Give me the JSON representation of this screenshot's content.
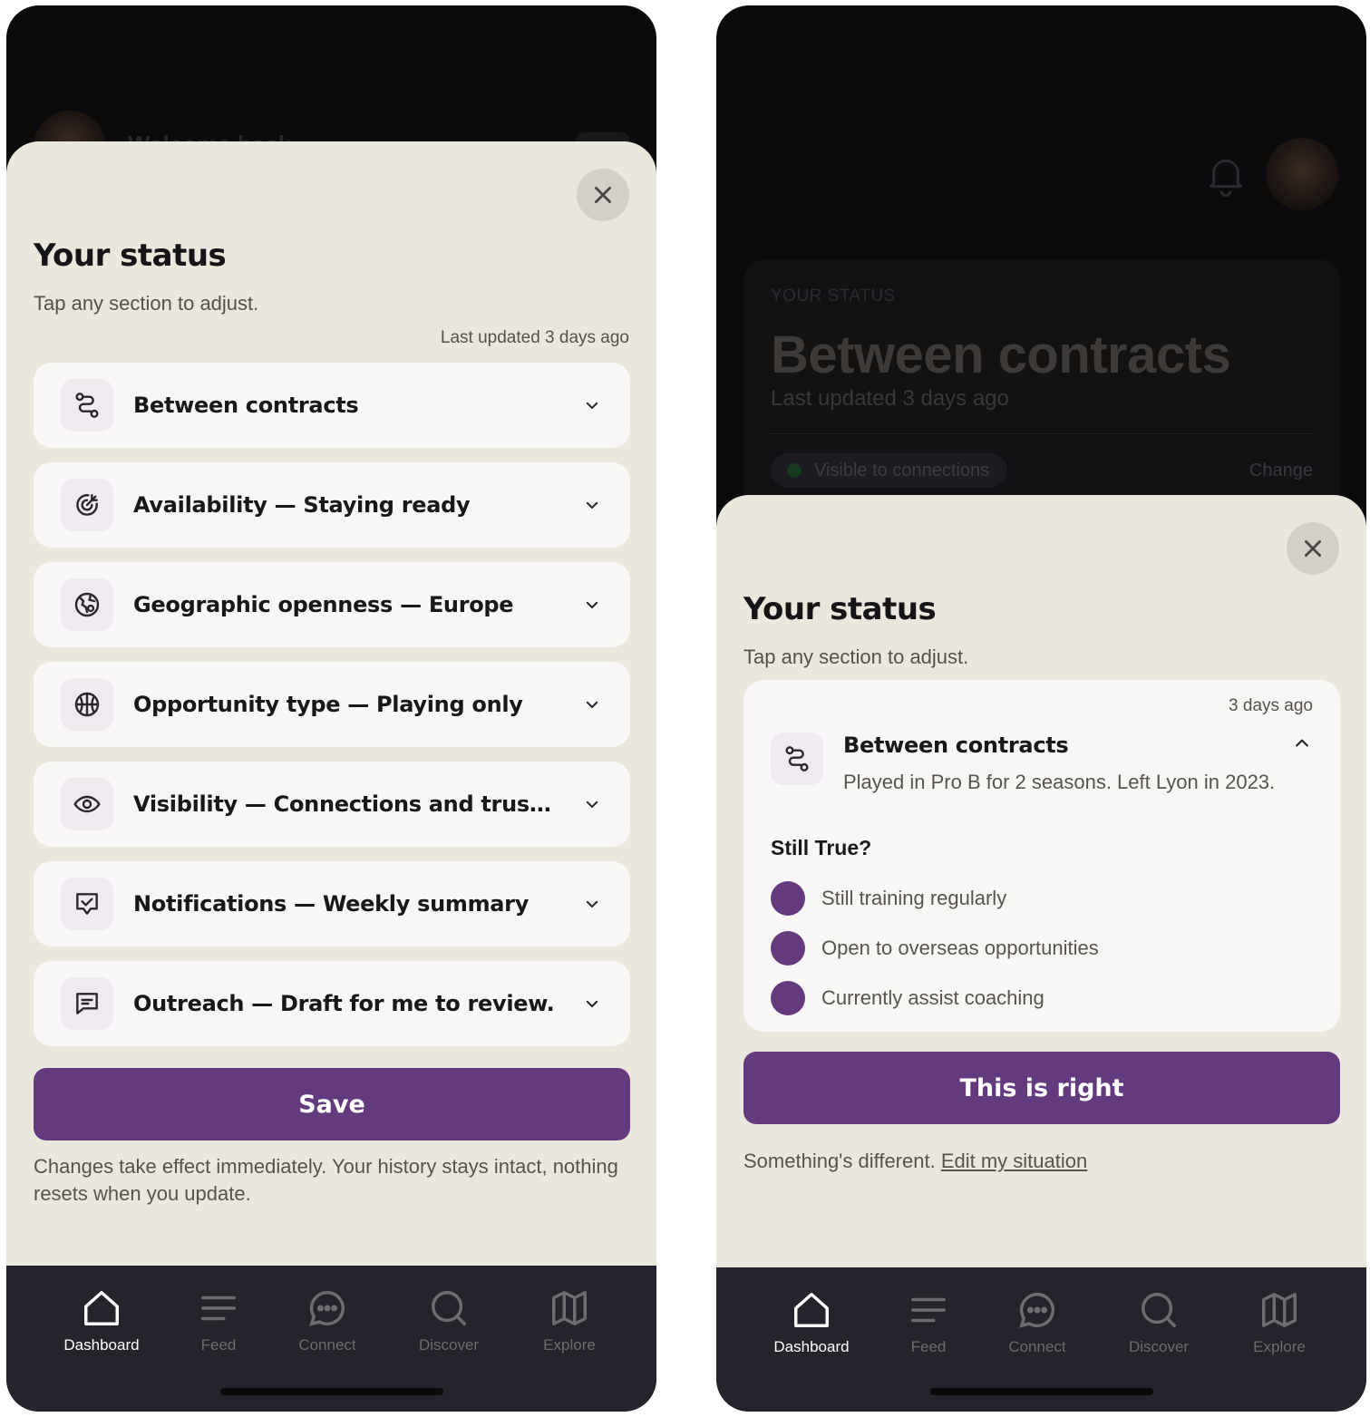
{
  "left": {
    "background": {
      "welcome_text": "Welcome back"
    },
    "sheet": {
      "title": "Your status",
      "subtitle": "Tap any section to adjust.",
      "last_updated": "Last updated 3 days ago",
      "rows": [
        {
          "label": "Between contracts",
          "icon": "route-icon"
        },
        {
          "label": "Availability — Staying ready",
          "icon": "target-icon"
        },
        {
          "label": "Geographic openness — Europe",
          "icon": "globe-pin-icon"
        },
        {
          "label": "Opportunity type — Playing only",
          "icon": "basketball-icon"
        },
        {
          "label": "Visibility — Connections and trusted ne…",
          "icon": "eye-icon"
        },
        {
          "label": "Notifications — Weekly summary",
          "icon": "check-shield-icon"
        },
        {
          "label": "Outreach — Draft for me to review.",
          "icon": "message-icon"
        }
      ],
      "save_label": "Save",
      "footnote": "Changes take effect immediately. Your history stays intact, nothing resets when you update."
    }
  },
  "right": {
    "background": {
      "card_label": "YOUR STATUS",
      "card_title": "Between contracts",
      "card_sub": "Last updated 3 days ago",
      "visibility_pill": "Visible to connections",
      "change_label": "Change"
    },
    "sheet": {
      "title": "Your status",
      "subtitle": "Tap any section to adjust.",
      "expanded": {
        "ago": "3 days ago",
        "title": "Between contracts",
        "description": "Played in Pro B for 2 seasons. Left Lyon in 2023.",
        "still_true_label": "Still True?",
        "checks": [
          "Still training regularly",
          "Open to overseas opportunities",
          "Currently assist coaching"
        ]
      },
      "confirm_label": "This is right",
      "different_text": "Something's different.",
      "edit_link": "Edit my situation"
    }
  },
  "tabs": [
    {
      "label": "Dashboard",
      "icon": "home-icon",
      "active": true
    },
    {
      "label": "Feed",
      "icon": "feed-icon",
      "active": false
    },
    {
      "label": "Connect",
      "icon": "chat-icon",
      "active": false
    },
    {
      "label": "Discover",
      "icon": "search-icon",
      "active": false
    },
    {
      "label": "Explore",
      "icon": "map-icon",
      "active": false
    }
  ],
  "colors": {
    "sheet_bg": "#eae7dc",
    "accent": "#643a7e",
    "tabbar_bg": "#25232b"
  }
}
